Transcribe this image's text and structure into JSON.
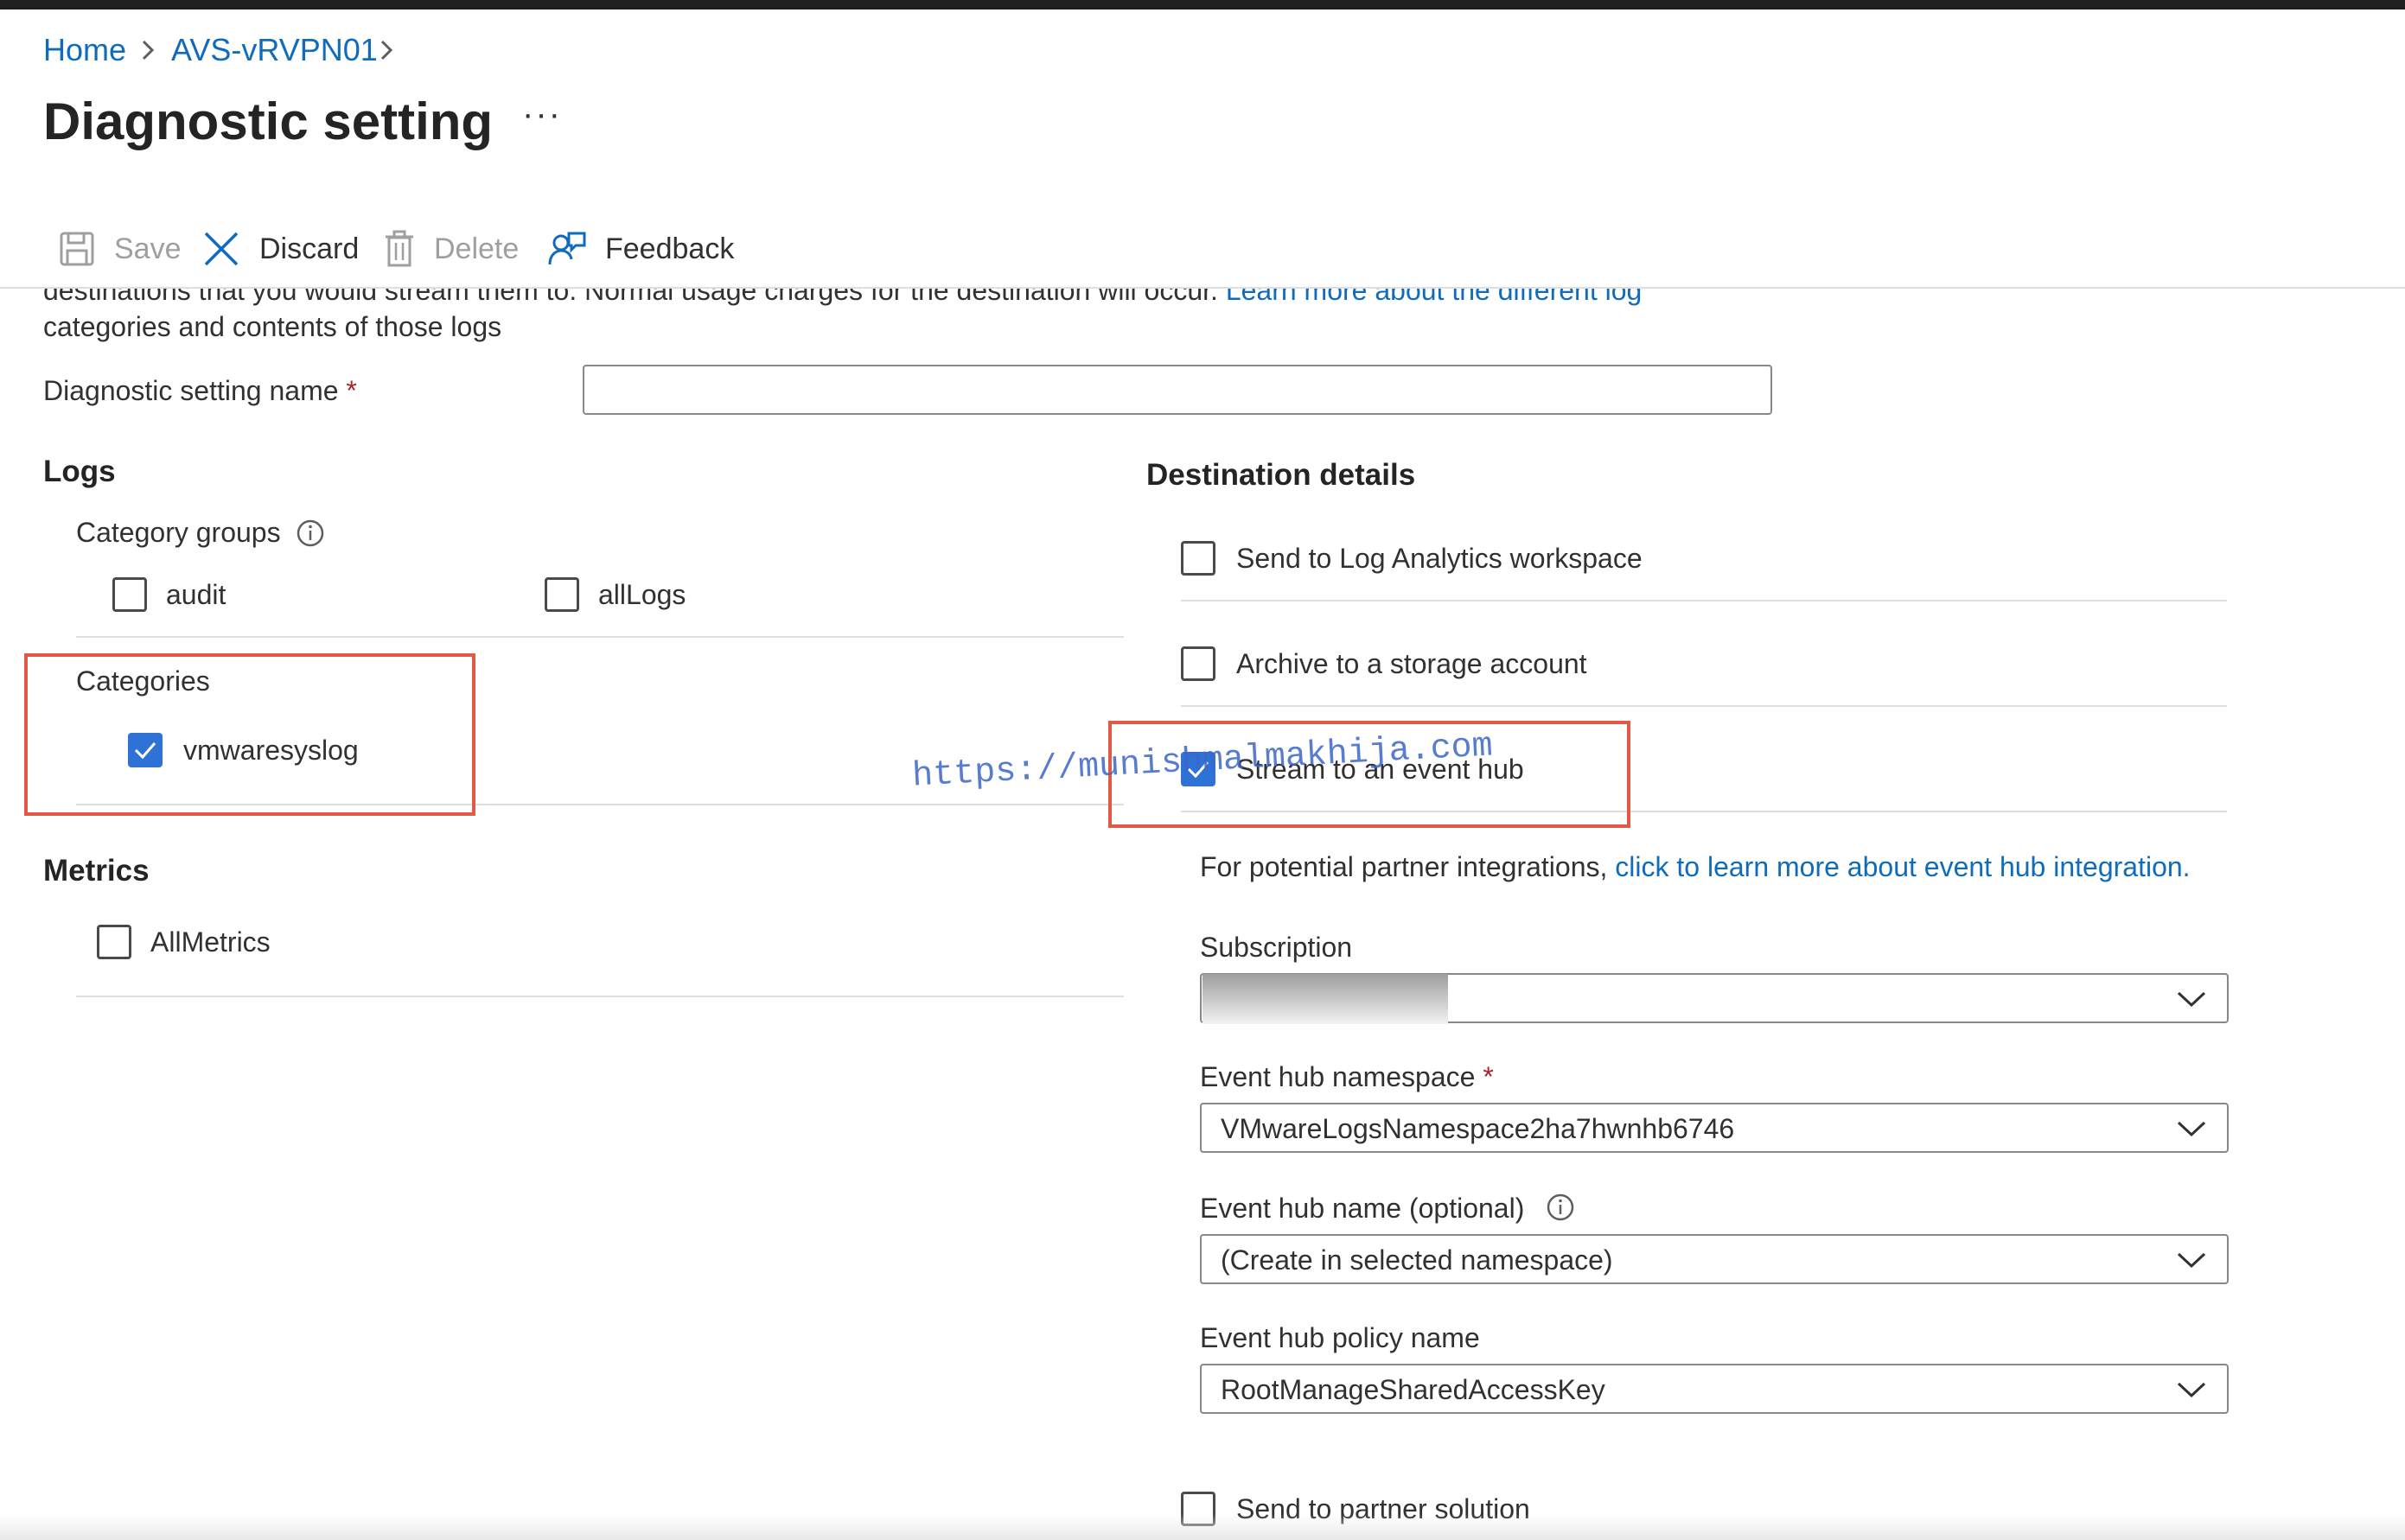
{
  "breadcrumb": {
    "home": "Home",
    "resource": "AVS-vRVPN01"
  },
  "page": {
    "title": "Diagnostic setting",
    "more": "···"
  },
  "toolbar": {
    "save": "Save",
    "discard": "Discard",
    "delete": "Delete",
    "feedback": "Feedback"
  },
  "intro": {
    "text_cut": "destinations that you would stream them to. Normal usage charges for the destination will occur.",
    "link_part1": "Learn more about the different log",
    "link_part2": "categories and contents of those logs"
  },
  "setting_name": {
    "label": "Diagnostic setting name",
    "required": "*",
    "value": ""
  },
  "logs": {
    "title": "Logs",
    "category_groups_label": "Category groups",
    "category_groups": [
      {
        "label": "audit",
        "checked": false
      },
      {
        "label": "allLogs",
        "checked": false
      }
    ],
    "categories_label": "Categories",
    "categories": [
      {
        "label": "vmwaresyslog",
        "checked": true
      }
    ]
  },
  "metrics": {
    "title": "Metrics",
    "items": [
      {
        "label": "AllMetrics",
        "checked": false
      }
    ]
  },
  "destination": {
    "title": "Destination details",
    "log_analytics": "Send to Log Analytics workspace",
    "storage": "Archive to a storage account",
    "event_hub": "Stream to an event hub",
    "partner_text": "For potential partner integrations,",
    "partner_link": "click to learn more about event hub integration.",
    "subscription_label": "Subscription",
    "subscription_value": "",
    "namespace_label": "Event hub namespace",
    "namespace_required": "*",
    "namespace_value": "VMwareLogsNamespace2ha7hwnhb6746",
    "hub_name_label": "Event hub name (optional)",
    "hub_name_value": "(Create in selected namespace)",
    "policy_label": "Event hub policy name",
    "policy_value": "RootManageSharedAccessKey",
    "partner_solution": "Send to partner solution"
  },
  "watermark": "https://munishmalmakhija.com",
  "colors": {
    "accent": "#0f6cbd",
    "checkbox_checked": "#2f72d6",
    "highlight": "#e15a45",
    "required": "#a4262c"
  }
}
